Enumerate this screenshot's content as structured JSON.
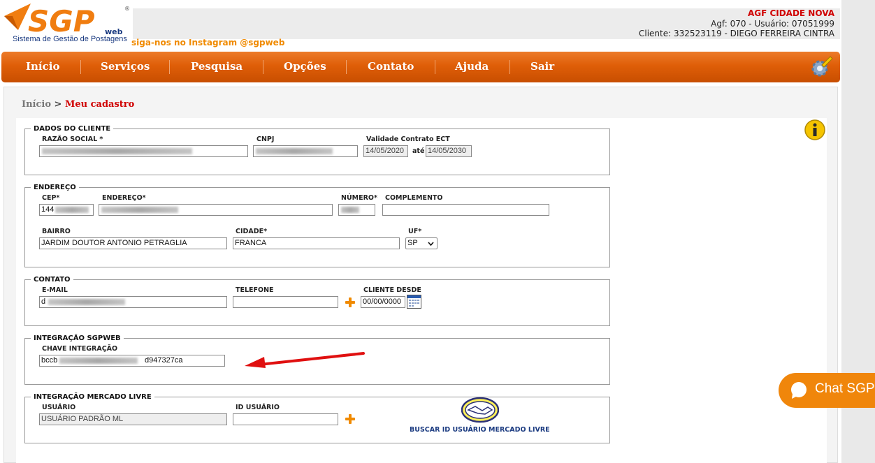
{
  "header": {
    "logo_sub": "Sistema de Gestão de Postagens",
    "instagram": "siga-nos no Instagram @sgpweb",
    "agency": "AGF CIDADE NOVA",
    "agency_user": "Agf: 070 - Usuário: 07051999",
    "client": "Cliente: 332523119 - DIEGO FERREIRA CINTRA"
  },
  "nav": {
    "items": [
      "Início",
      "Serviços",
      "Pesquisa",
      "Opções",
      "Contato",
      "Ajuda",
      "Sair"
    ]
  },
  "breadcrumb": {
    "home": "Início",
    "sep": ">",
    "current": "Meu cadastro"
  },
  "dados_cliente": {
    "legend": "DADOS DO CLIENTE",
    "razao_label": "RAZÃO SOCIAL *",
    "cnpj_label": "CNPJ",
    "validade_label": "Validade Contrato ECT",
    "validade_de": "14/05/2020",
    "ate": "até",
    "validade_ate": "14/05/2030"
  },
  "endereco": {
    "legend": "ENDEREÇO",
    "cep_label": "CEP*",
    "cep_value": "144",
    "endereco_label": "ENDEREÇO*",
    "numero_label": "NÚMERO*",
    "complemento_label": "COMPLEMENTO",
    "bairro_label": "BAIRRO",
    "bairro_value": "JARDIM DOUTOR ANTONIO PETRAGLIA",
    "cidade_label": "CIDADE*",
    "cidade_value": "FRANCA",
    "uf_label": "UF*",
    "uf_value": "SP"
  },
  "contato": {
    "legend": "CONTATO",
    "email_label": "E-MAIL",
    "email_value": "d",
    "telefone_label": "TELEFONE",
    "cliente_desde_label": "CLIENTE DESDE",
    "cliente_desde_value": "00/00/0000"
  },
  "integracao": {
    "legend": "INTEGRAÇÃO SGPWEB",
    "chave_label": "CHAVE INTEGRAÇÃO",
    "chave_prefix": "bccb",
    "chave_suffix": "d947327ca"
  },
  "mercado_livre": {
    "legend": "INTEGRAÇÃO MERCADO LIVRE",
    "usuario_label": "USUÁRIO",
    "usuario_value": "USUÁRIO PADRÃO ML",
    "id_label": "ID USUÁRIO",
    "buscar": "BUSCAR ID USUÁRIO MERCADO LIVRE"
  },
  "chat": {
    "label": "Chat SGP"
  },
  "colors": {
    "nav": "#df5e08",
    "accent_red": "#d00000",
    "orange": "#f08a00",
    "chat": "#f0860b"
  }
}
